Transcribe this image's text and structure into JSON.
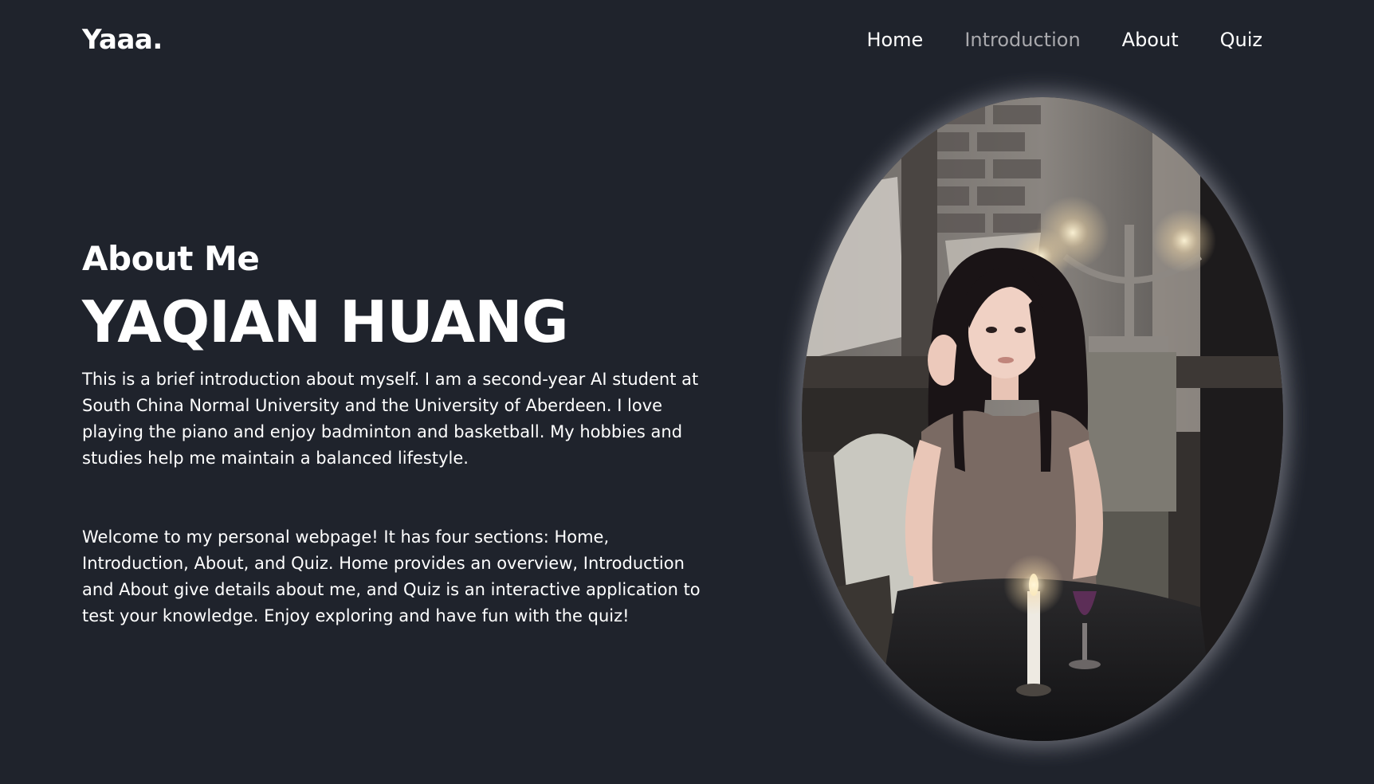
{
  "header": {
    "logo": "Yaaa.",
    "nav": [
      {
        "label": "Home",
        "active": false
      },
      {
        "label": "Introduction",
        "active": true
      },
      {
        "label": "About",
        "active": false
      },
      {
        "label": "Quiz",
        "active": false
      }
    ]
  },
  "main": {
    "section_title": "About Me",
    "name": "YAQIAN HUANG",
    "paragraphs": [
      "This is a brief introduction about myself. I am a second-year AI student at South China Normal University and the University of Aberdeen. I love playing the piano and enjoy badminton and basketball. My hobbies and studies help me maintain a balanced lifestyle.",
      "Welcome to my personal webpage! It has four sections: Home, Introduction, About, and Quiz. Home provides an overview, Introduction and About give details about me, and Quiz is an interactive application to test your knowledge. Enjoy exploring and have fun with the quiz!"
    ]
  },
  "colors": {
    "background": "#1f232c",
    "text": "#ffffff",
    "nav_active": "#a9a9ad"
  }
}
